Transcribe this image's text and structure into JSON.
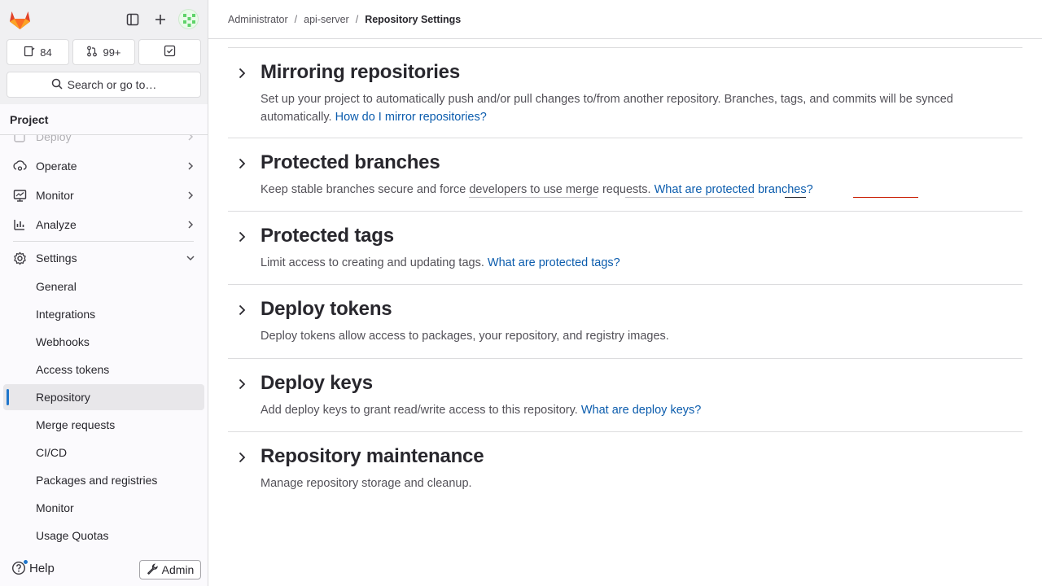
{
  "sidebar": {
    "counters": [
      {
        "icon": "issues-icon",
        "value": "84"
      },
      {
        "icon": "merge-request-icon",
        "value": "99+"
      },
      {
        "icon": "todo-icon",
        "value": ""
      }
    ],
    "search_label": "Search or go to…",
    "section_title": "Project",
    "nav_items": [
      {
        "label": "Deploy",
        "icon": "deploy-icon"
      },
      {
        "label": "Operate",
        "icon": "operate-icon"
      },
      {
        "label": "Monitor",
        "icon": "monitor-icon"
      },
      {
        "label": "Analyze",
        "icon": "analyze-icon"
      },
      {
        "label": "Settings",
        "icon": "settings-icon"
      }
    ],
    "settings_items": [
      {
        "label": "General"
      },
      {
        "label": "Integrations"
      },
      {
        "label": "Webhooks"
      },
      {
        "label": "Access tokens"
      },
      {
        "label": "Repository",
        "active": true
      },
      {
        "label": "Merge requests"
      },
      {
        "label": "CI/CD"
      },
      {
        "label": "Packages and registries"
      },
      {
        "label": "Monitor"
      },
      {
        "label": "Usage Quotas"
      }
    ],
    "help_label": "Help",
    "admin_label": "Admin"
  },
  "breadcrumb": {
    "items": [
      "Administrator",
      "api-server"
    ],
    "current": "Repository Settings"
  },
  "sections": [
    {
      "title": "Mirroring repositories",
      "description": "Set up your project to automatically push and/or pull changes to/from another repository. Branches, tags, and commits will be synced automatically.",
      "link": "How do I mirror repositories?"
    },
    {
      "title": "Protected branches",
      "description": "Keep stable branches secure and force developers to use merge requests.",
      "link": "What are protected branches?"
    },
    {
      "title": "Protected tags",
      "description": "Limit access to creating and updating tags.",
      "link": "What are protected tags?"
    },
    {
      "title": "Deploy tokens",
      "description": "Deploy tokens allow access to packages, your repository, and registry images.",
      "link": ""
    },
    {
      "title": "Deploy keys",
      "description": "Add deploy keys to grant read/write access to this repository.",
      "link": "What are deploy keys?"
    },
    {
      "title": "Repository maintenance",
      "description": "Manage repository storage and cleanup.",
      "link": ""
    }
  ],
  "colors": {
    "accent": "#1f75cb",
    "link": "#0b5cad",
    "border": "#dcdcde",
    "sidebar_bg": "#fbfafd"
  }
}
